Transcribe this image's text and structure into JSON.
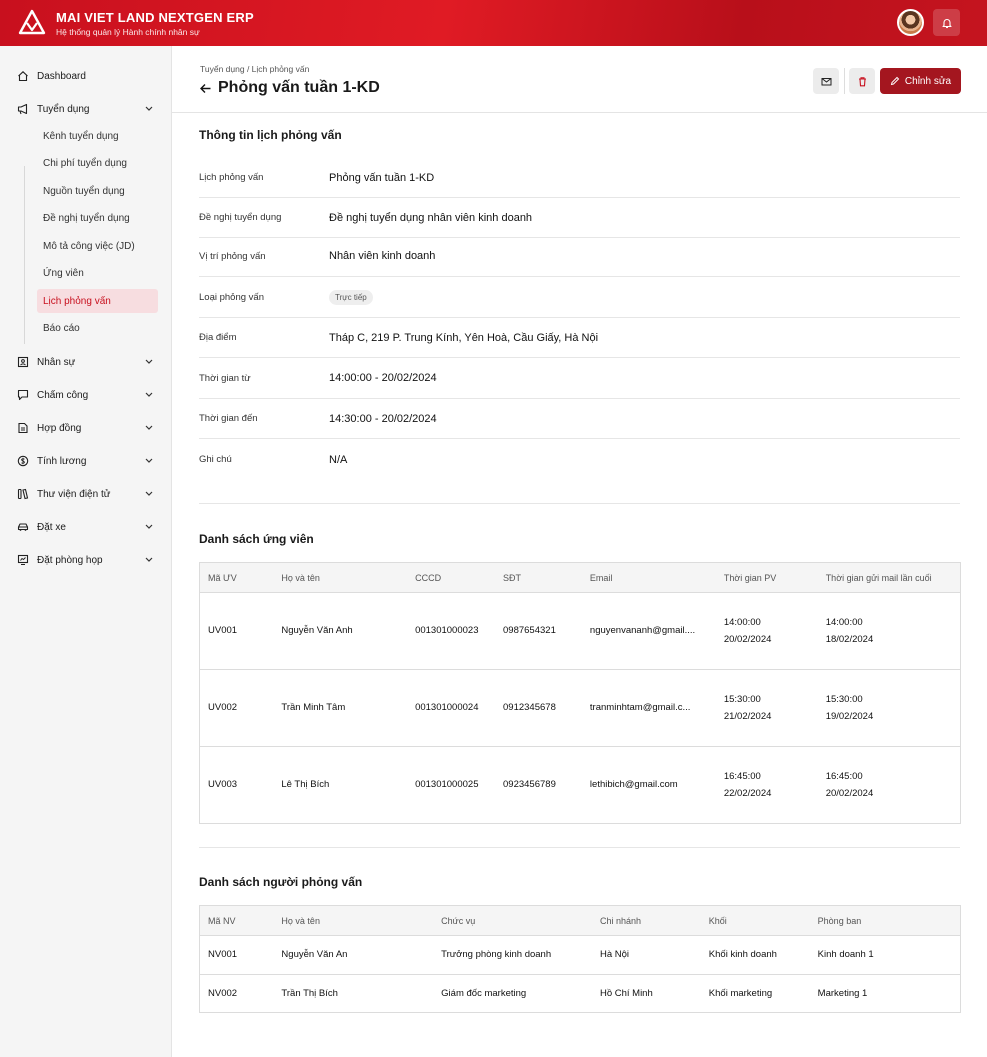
{
  "header": {
    "brand_title": "MAI VIET LAND NEXTGEN ERP",
    "brand_subtitle": "Hệ thống quản lý Hành chính nhân sự",
    "icons": [
      "logo-icon",
      "avatar",
      "bell-icon"
    ]
  },
  "sidebar": {
    "items": [
      {
        "label": "Dashboard",
        "icon": "home-icon"
      },
      {
        "label": "Tuyển dụng",
        "icon": "megaphone-icon"
      },
      {
        "label": "Nhân sự",
        "icon": "id-card-icon"
      },
      {
        "label": "Chấm công",
        "icon": "clock-icon"
      },
      {
        "label": "Hợp đồng",
        "icon": "document-icon"
      },
      {
        "label": "Tính lương",
        "icon": "dollar-icon"
      },
      {
        "label": "Thư viện điện tử",
        "icon": "library-icon"
      },
      {
        "label": "Đặt xe",
        "icon": "car-icon"
      },
      {
        "label": "Đặt phòng họp",
        "icon": "meeting-icon"
      }
    ],
    "sub_items": [
      {
        "label": "Kênh tuyển dụng"
      },
      {
        "label": "Chi phí tuyển dụng"
      },
      {
        "label": "Nguồn tuyển dụng"
      },
      {
        "label": "Đề nghị tuyển dụng"
      },
      {
        "label": "Mô tả công việc (JD)"
      },
      {
        "label": "Ứng viên"
      },
      {
        "label": "Lịch phỏng vấn",
        "active": true
      },
      {
        "label": "Báo cáo"
      }
    ],
    "accent_color": "#c8101e"
  },
  "page": {
    "breadcrumb": "Tuyển dụng / Lịch phỏng vấn",
    "title": "Phỏng vấn tuần 1-KD",
    "edit_label": "Chỉnh sửa"
  },
  "info": {
    "section_title": "Thông tin lịch phỏng vấn",
    "rows": [
      {
        "label": "Lịch phỏng vấn",
        "value": "Phỏng vấn tuần 1-KD"
      },
      {
        "label": "Đề nghị tuyển dụng",
        "value": "Đề nghị tuyển dụng nhân viên kinh doanh"
      },
      {
        "label": "Vị trí phỏng vấn",
        "value": "Nhân viên kinh doanh"
      },
      {
        "label": "Loại phỏng vấn",
        "value": "Trực tiếp"
      },
      {
        "label": "Địa điểm",
        "value": "Tháp C, 219 P. Trung Kính, Yên Hoà, Cầu Giấy, Hà Nội"
      },
      {
        "label": "Thời gian từ",
        "value": "14:00:00 - 20/02/2024"
      },
      {
        "label": "Thời gian đến",
        "value": "14:30:00 - 20/02/2024"
      },
      {
        "label": "Ghi chú",
        "value": "N/A"
      }
    ]
  },
  "candidates": {
    "section_title": "Danh sách ứng viên",
    "columns": [
      "Mã ƯV",
      "Họ và tên",
      "CCCD",
      "SĐT",
      "Email",
      "Thời gian PV",
      "Thời gian gửi mail lần cuối"
    ],
    "rows": [
      {
        "code": "UV001",
        "name": "Nguyễn Văn Anh",
        "id": "001301000023",
        "phone": "0987654321",
        "email": "nguyenvananh@gmail....",
        "pv_time": "14:00:00",
        "pv_date": "20/02/2024",
        "mail_time": "14:00:00",
        "mail_date": "18/02/2024"
      },
      {
        "code": "UV002",
        "name": "Trần Minh Tâm",
        "id": "001301000024",
        "phone": "0912345678",
        "email": "tranminhtam@gmail.c...",
        "pv_time": "15:30:00",
        "pv_date": "21/02/2024",
        "mail_time": "15:30:00",
        "mail_date": "19/02/2024"
      },
      {
        "code": "UV003",
        "name": "Lê Thị Bích",
        "id": "001301000025",
        "phone": "0923456789",
        "email": "lethibich@gmail.com",
        "pv_time": "16:45:00",
        "pv_date": "22/02/2024",
        "mail_time": "16:45:00",
        "mail_date": "20/02/2024"
      }
    ]
  },
  "interviewers": {
    "section_title": "Danh sách người phỏng vấn",
    "columns": [
      "Mã NV",
      "Họ và tên",
      "Chức vụ",
      "Chi nhánh",
      "Khối",
      "Phòng ban"
    ],
    "rows": [
      {
        "code": "NV001",
        "name": "Nguyễn Văn An",
        "title": "Trưởng phòng kinh doanh",
        "branch": "Hà Nội",
        "division": "Khối kinh doanh",
        "dept": "Kinh doanh 1"
      },
      {
        "code": "NV002",
        "name": "Trần Thị Bích",
        "title": "Giám đốc marketing",
        "branch": "Hồ Chí Minh",
        "division": "Khối marketing",
        "dept": "Marketing 1"
      }
    ]
  }
}
